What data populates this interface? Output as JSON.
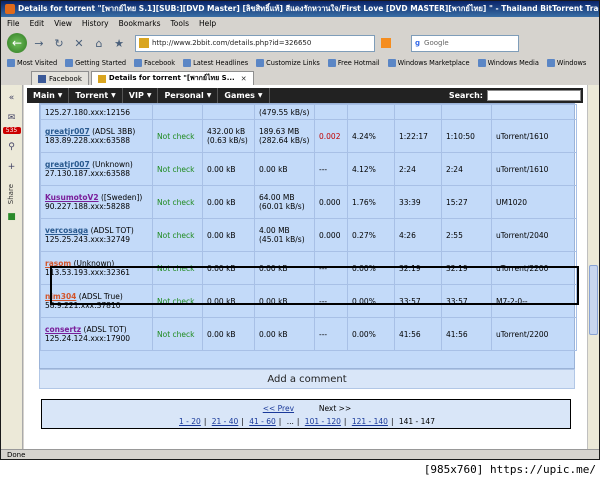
{
  "window": {
    "title": "Details for torrent \"[พากย์ไทย S.1][SUB:][DVD Master] [ลิขสิทธิ์แท้] สีแดงรักหวานใจ/First Love [DVD MASTER][พากย์ไทย] \" - Thailand BitTorrent Tracker -"
  },
  "menubar": [
    "File",
    "Edit",
    "View",
    "History",
    "Bookmarks",
    "Tools",
    "Help"
  ],
  "navbar": {
    "url": "http://www.2bbit.com/details.php?id=326650",
    "search_placeholder": "Google"
  },
  "bookmarks": [
    "Most Visited",
    "Getting Started",
    "Facebook",
    "Latest Headlines",
    "Customize Links",
    "Free Hotmail",
    "Windows Marketplace",
    "Windows Media",
    "Windows"
  ],
  "tabs": [
    {
      "label": "Facebook"
    },
    {
      "label": "Details for torrent \"[พากย์ไทย S..."
    }
  ],
  "sidebar": {
    "count": "535",
    "share_label": "Share"
  },
  "site_menu": {
    "items": [
      "Main",
      "Torrent",
      "VIP",
      "Personal",
      "Games"
    ],
    "search_label": "Search:"
  },
  "peers_partial": {
    "ip": "125.27.180.xxx:12156",
    "rate": "(479.55 kB/s)"
  },
  "peers": [
    {
      "name": "greatjr007",
      "meta": "(ADSL 3BB)",
      "ip": "183.89.228.xxx:63588",
      "connectable": "Not check",
      "up": "432.00 kB",
      "up_rate": "(0.63 kB/s)",
      "down": "189.63 MB",
      "down_rate": "(282.64 kB/s)",
      "ratio": "0.002",
      "complete": "4.24%",
      "connected": "1:22:17",
      "idle": "1:10:50",
      "client": "uTorrent/1610",
      "color": "blue",
      "ratio_color": "red"
    },
    {
      "name": "greatjr007",
      "meta": "(Unknown)",
      "ip": "27.130.187.xxx:63588",
      "connectable": "Not check",
      "up": "0.00 kB",
      "up_rate": "",
      "down": "0.00 kB",
      "down_rate": "",
      "ratio": "---",
      "complete": "4.12%",
      "connected": "2:24",
      "idle": "2:24",
      "client": "uTorrent/1610",
      "color": "blue",
      "ratio_color": "normal"
    },
    {
      "name": "KusumotoV2",
      "meta": "([Sweden])",
      "ip": "90.227.188.xxx:58288",
      "connectable": "Not check",
      "up": "0.00 kB",
      "up_rate": "",
      "down": "64.00 MB",
      "down_rate": "(60.01 kB/s)",
      "ratio": "0.000",
      "complete": "1.76%",
      "connected": "33:39",
      "idle": "15:27",
      "client": "UM1020",
      "color": "purple",
      "ratio_color": "normal"
    },
    {
      "name": "vercosaga",
      "meta": "(ADSL TOT)",
      "ip": "125.25.243.xxx:32749",
      "connectable": "Not check",
      "up": "0.00 kB",
      "up_rate": "",
      "down": "4.00 MB",
      "down_rate": "(45.01 kB/s)",
      "ratio": "0.000",
      "complete": "0.27%",
      "connected": "4:26",
      "idle": "2:55",
      "client": "uTorrent/2040",
      "color": "blue",
      "ratio_color": "normal"
    },
    {
      "name": "rasom",
      "meta": "(Unknown)",
      "ip": "113.53.193.xxx:32361",
      "connectable": "Not check",
      "up": "0.00 kB",
      "up_rate": "",
      "down": "0.00 kB",
      "down_rate": "",
      "ratio": "---",
      "complete": "0.00%",
      "connected": "32:19",
      "idle": "32:19",
      "client": "uTorrent/2200",
      "color": "orange",
      "ratio_color": "normal"
    },
    {
      "name": "nim304",
      "meta": "(ADSL True)",
      "ip": "58.9.221.xxx:37810",
      "connectable": "Not check",
      "up": "0.00 kB",
      "up_rate": "",
      "down": "0.00 kB",
      "down_rate": "",
      "ratio": "---",
      "complete": "0.00%",
      "connected": "33:57",
      "idle": "33:57",
      "client": "M7-2-0--",
      "color": "orange",
      "ratio_color": "normal"
    },
    {
      "name": "consertz",
      "meta": "(ADSL TOT)",
      "ip": "125.24.124.xxx:17900",
      "connectable": "Not check",
      "up": "0.00 kB",
      "up_rate": "",
      "down": "0.00 kB",
      "down_rate": "",
      "ratio": "---",
      "complete": "0.00%",
      "connected": "41:56",
      "idle": "41:56",
      "client": "uTorrent/2200",
      "color": "purple",
      "ratio_color": "normal"
    }
  ],
  "comment": {
    "label": "Add a comment"
  },
  "pager": {
    "prev": "<< Prev",
    "next": "Next >>",
    "pages": [
      "1 - 20",
      "21 - 40",
      "41 - 60",
      "...",
      "101 - 120",
      "121 - 140"
    ],
    "current": "141 - 147"
  },
  "status": {
    "text": "Done"
  },
  "watermark": {
    "text": "[985x760] https://upic.me/"
  }
}
